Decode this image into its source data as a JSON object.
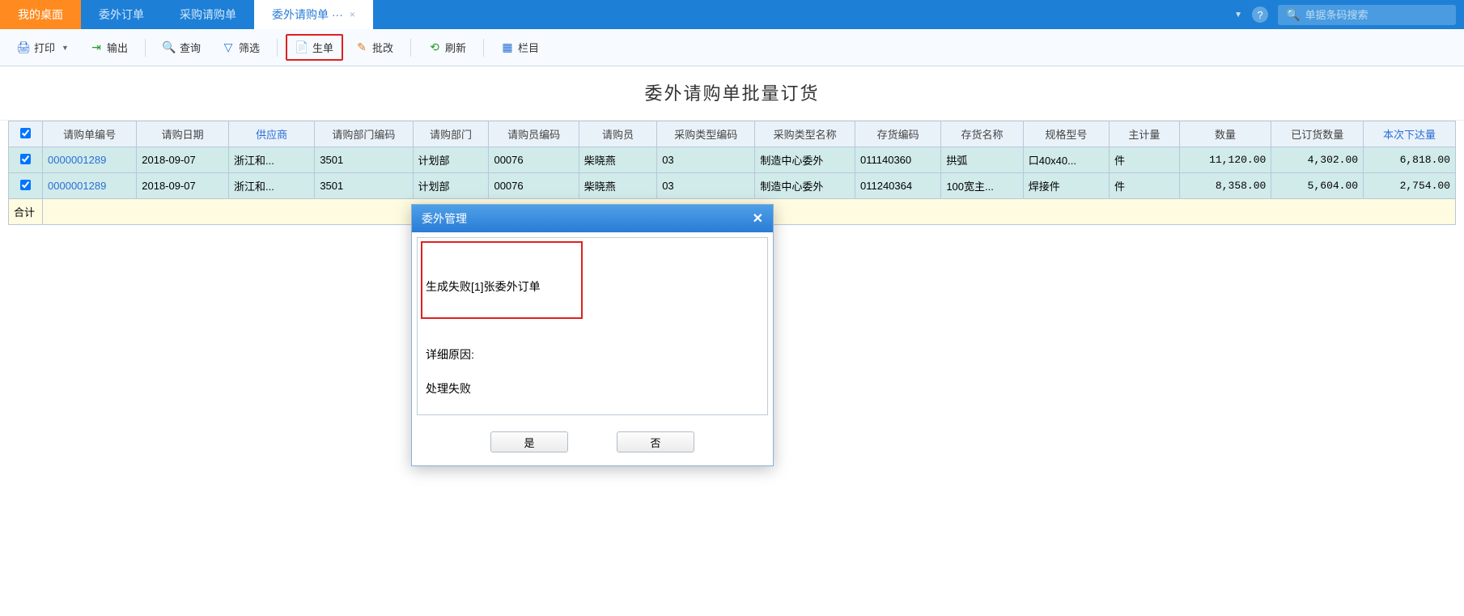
{
  "tabs": {
    "desktop": "我的桌面",
    "tab1": "委外订单",
    "tab2": "采购请购单",
    "active": "委外请购单 ···",
    "close": "×"
  },
  "topbar": {
    "help": "?",
    "search_placeholder": "单据条码搜索"
  },
  "toolbar": {
    "print": "打印",
    "export": "输出",
    "query": "查询",
    "filter": "筛选",
    "generate": "生单",
    "batch": "批改",
    "refresh": "刷新",
    "column": "栏目"
  },
  "page_title": "委外请购单批量订货",
  "columns": {
    "c0": "",
    "c1": "请购单编号",
    "c2": "请购日期",
    "c3": "供应商",
    "c4": "请购部门编码",
    "c5": "请购部门",
    "c6": "请购员编码",
    "c7": "请购员",
    "c8": "采购类型编码",
    "c9": "采购类型名称",
    "c10": "存货编码",
    "c11": "存货名称",
    "c12": "规格型号",
    "c13": "主计量",
    "c14": "数量",
    "c15": "已订货数量",
    "c16": "本次下达量"
  },
  "rows": [
    {
      "r1": "0000001289",
      "r2": "2018-09-07",
      "r3": "浙江和...",
      "r4": "3501",
      "r5": "计划部",
      "r6": "00076",
      "r7": "柴晓燕",
      "r8": "03",
      "r9": "制造中心委外",
      "r10": "011140360",
      "r11": "拱弧",
      "r12": "口40x40...",
      "r13": "件",
      "r14": "11,120.00",
      "r15": "4,302.00",
      "r16": "6,818.00"
    },
    {
      "r1": "0000001289",
      "r2": "2018-09-07",
      "r3": "浙江和...",
      "r4": "3501",
      "r5": "计划部",
      "r6": "00076",
      "r7": "柴晓燕",
      "r8": "03",
      "r9": "制造中心委外",
      "r10": "011240364",
      "r11": "100宽主...",
      "r12": "焊接件",
      "r13": "件",
      "r14": "8,358.00",
      "r15": "5,604.00",
      "r16": "2,754.00"
    }
  ],
  "sum_label": "合计",
  "dialog": {
    "title": "委外管理",
    "body_line1": "生成失败[1]张委外订单",
    "body_line2": "详细原因:",
    "body_line3": "处理失败",
    "yes": "是",
    "no": "否"
  }
}
